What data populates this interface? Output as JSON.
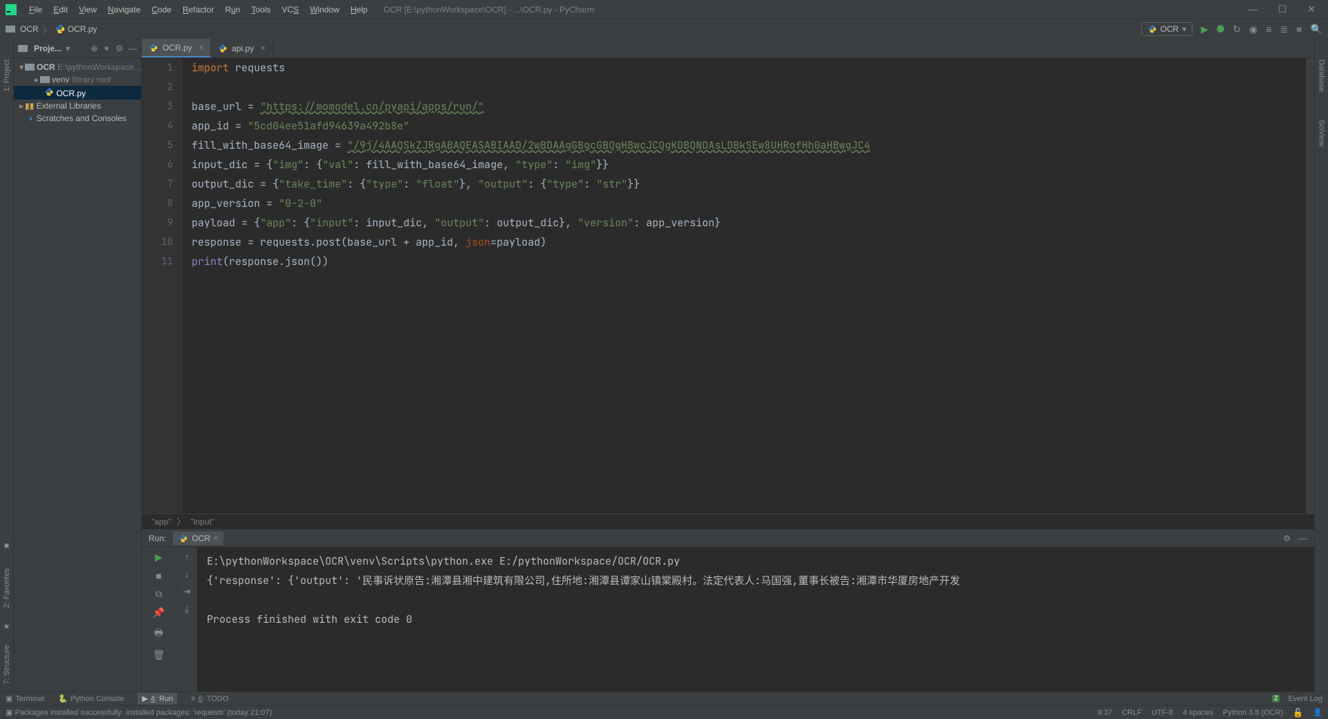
{
  "menu": {
    "items": [
      "File",
      "Edit",
      "View",
      "Navigate",
      "Code",
      "Refactor",
      "Run",
      "Tools",
      "VCS",
      "Window",
      "Help"
    ],
    "title": "OCR [E:\\pythonWorkspace\\OCR] - ...\\OCR.py - PyCharm"
  },
  "breadcrumb": {
    "root": "OCR",
    "file": "OCR.py"
  },
  "run_config": {
    "name": "OCR"
  },
  "project_panel": {
    "title": "Proje..."
  },
  "tree": {
    "root": {
      "name": "OCR",
      "path": "E:\\pythonWorkspace..."
    },
    "venv": {
      "name": "venv",
      "hint": "library root"
    },
    "file": "OCR.py",
    "ext_lib": "External Libraries",
    "scratch": "Scratches and Consoles"
  },
  "tabs": [
    {
      "name": "OCR.py",
      "active": true
    },
    {
      "name": "api.py",
      "active": false
    }
  ],
  "code": {
    "lines": [
      "1",
      "2",
      "3",
      "4",
      "5",
      "6",
      "7",
      "8",
      "9",
      "10",
      "11"
    ],
    "l1_kw": "import",
    "l1_id": "requests",
    "l3_var": "base_url",
    "l3_eq": " = ",
    "l3_url": "\"https://momodel.cn/pyapi/apps/run/\"",
    "l4_var": "app_id",
    "l4_eq": " = ",
    "l4_val": "\"5cd04ee51afd94639a492b8e\"",
    "l5_var": "fill_with_base64_image",
    "l5_eq": " = ",
    "l5_val": "\"/9j/4AAQSkZJRgABAQEASABIAAD/2wBDAAgGBgcGBQgHBwcJCQgKDBQNDAsLDBkSEw8UHRofHh0aHBwgJC4",
    "l6_var": "input_dic",
    "l6_eq": " = {",
    "l6_k1": "\"img\"",
    "l6_c": ": {",
    "l6_k2": "\"val\"",
    "l6_c2": ": fill_with_base64_image, ",
    "l6_k3": "\"type\"",
    "l6_c3": ": ",
    "l6_v3": "\"img\"",
    "l6_end": "}}",
    "l7_var": "output_dic",
    "l7_eq": " = {",
    "l7_k1": "\"take_time\"",
    "l7_c": ": {",
    "l7_k2": "\"type\"",
    "l7_c2": ": ",
    "l7_v2": "\"float\"",
    "l7_c3": "}, ",
    "l7_k3": "\"output\"",
    "l7_c4": ": {",
    "l7_k4": "\"type\"",
    "l7_c5": ": ",
    "l7_v4": "\"str\"",
    "l7_end": "}}",
    "l8_var": "app_version",
    "l8_eq": " = ",
    "l8_val": "\"0-2-0\"",
    "l9_var": "payload",
    "l9_eq": " = {",
    "l9_k1": "\"app\"",
    "l9_c": ": {",
    "l9_k2": "\"input\"",
    "l9_c2": ": input_dic, ",
    "l9_k3": "\"output\"",
    "l9_c3": ": output_dic}, ",
    "l9_k4": "\"version\"",
    "l9_c4": ": app_version}",
    "l10": "response = requests.post(base_url + app_id, ",
    "l10_param": "json",
    "l10_end": "=payload)",
    "l11_fn": "print",
    "l11_body": "(response.json())"
  },
  "editor_crumb": {
    "a": "\"app\"",
    "b": "\"input\""
  },
  "run": {
    "label": "Run:",
    "tab": "OCR",
    "line1": "E:\\pythonWorkspace\\OCR\\venv\\Scripts\\python.exe E:/pythonWorkspace/OCR/OCR.py",
    "line2": "{'response': {'output': '民事诉状原告:湘潭县湘中建筑有限公司,住所地:湘潭县谭家山镇棠殿村。法定代表人:马国强,董事长被告:湘潭市华厦房地产开发",
    "line3": "",
    "line4": "Process finished with exit code 0"
  },
  "bottom_tabs": {
    "terminal": "Terminal",
    "py_console": "Python Console",
    "run": "4: Run",
    "todo": "6: TODO",
    "event_log": "Event Log",
    "event_badge": "2"
  },
  "status": {
    "msg": "Packages installed successfully: Installed packages: 'requests' (today 21:07)",
    "pos": "9:37",
    "lineend": "CRLF",
    "enc": "UTF-8",
    "indent": "4 spaces",
    "interp": "Python 3.8 (OCR)"
  },
  "left_labels": {
    "project": "1: Project",
    "favorites": "2: Favorites",
    "structure": "7: Structure"
  },
  "right_labels": {
    "database": "Database",
    "sciview": "SciView"
  }
}
